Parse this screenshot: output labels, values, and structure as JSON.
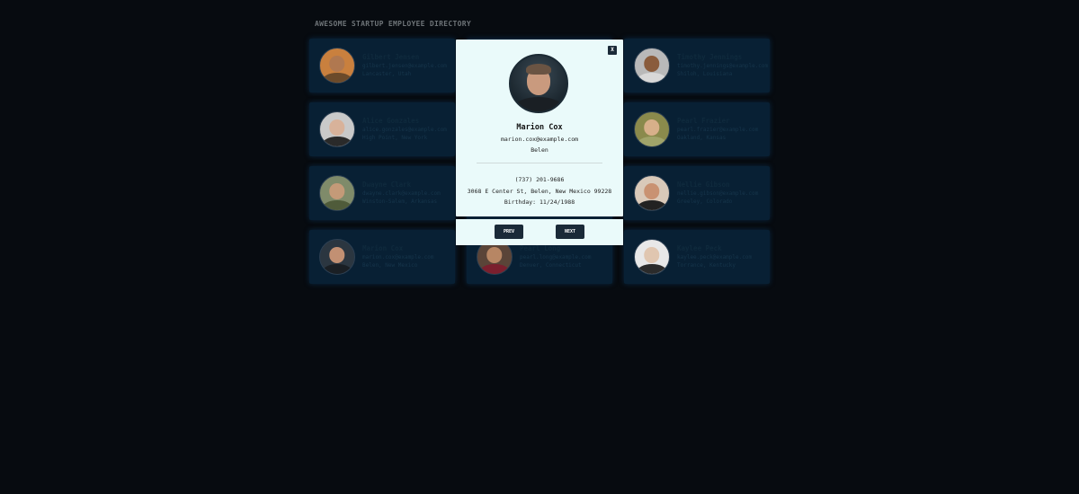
{
  "page": {
    "title": "AWESOME STARTUP EMPLOYEE DIRECTORY"
  },
  "employees": [
    {
      "name": "Gilbert Jensen",
      "email": "gilbert.jensen@example.com",
      "location": "Lancaster, Utah",
      "skin": "#b07850",
      "shirt": "#6b4a2a",
      "bg": "#c9803e"
    },
    {
      "name": "",
      "email": "",
      "location": "",
      "skin": "#c99a7e",
      "shirt": "#333",
      "bg": "#0b2236"
    },
    {
      "name": "Timothy Jennings",
      "email": "timothy.jennings@example.com",
      "location": "Shiloh, Louisiana",
      "skin": "#8a5c3c",
      "shirt": "#d8d8d8",
      "bg": "#b9b9b9"
    },
    {
      "name": "Alice Gonzales",
      "email": "alice.gonzales@example.com",
      "location": "High Point, New York",
      "skin": "#d8b29a",
      "shirt": "#2a2a2a",
      "bg": "#c9c9c9"
    },
    {
      "name": "",
      "email": "",
      "location": "",
      "skin": "#c99a7e",
      "shirt": "#333",
      "bg": "#0b2236"
    },
    {
      "name": "Pearl Frazier",
      "email": "pearl.frazier@example.com",
      "location": "Oakland, Kansas",
      "skin": "#d7b08a",
      "shirt": "#a0a46a",
      "bg": "#8a8a4c"
    },
    {
      "name": "Dwayne Clark",
      "email": "dwayne.clark@example.com",
      "location": "Winston-Salem, Arkansas",
      "skin": "#c49a78",
      "shirt": "#4f5b3a",
      "bg": "#7f8b6a"
    },
    {
      "name": "",
      "email": "",
      "location": "",
      "skin": "#c99a7e",
      "shirt": "#333",
      "bg": "#0b2236"
    },
    {
      "name": "Nellie Gibson",
      "email": "nellie.gibson@example.com",
      "location": "Greeley, Colorado",
      "skin": "#c99272",
      "shirt": "#222",
      "bg": "#d9c9b9"
    },
    {
      "name": "Marion Cox",
      "email": "marion.cox@example.com",
      "location": "Belen, New Mexico",
      "skin": "#c29073",
      "shirt": "#1a1f24",
      "bg": "#2b3640"
    },
    {
      "name": "Pearl Long",
      "email": "pearl.long@example.com",
      "location": "Denver, Connecticut",
      "skin": "#b78664",
      "shirt": "#7b1f2e",
      "bg": "#5a4438"
    },
    {
      "name": "Kaylee Peck",
      "email": "kaylee.peck@example.com",
      "location": "Torrance, Kentucky",
      "skin": "#e0c6b0",
      "shirt": "#2b2b2b",
      "bg": "#e8e8e8"
    }
  ],
  "modal": {
    "close_label": "X",
    "name": "Marion Cox",
    "email": "marion.cox@example.com",
    "city": "Belen",
    "phone": "(737) 201-9686",
    "address": "3068 E Center St, Belen, New Mexico 99228",
    "birthday": "Birthday: 11/24/1988",
    "prev_label": "PREV",
    "next_label": "NEXT"
  }
}
